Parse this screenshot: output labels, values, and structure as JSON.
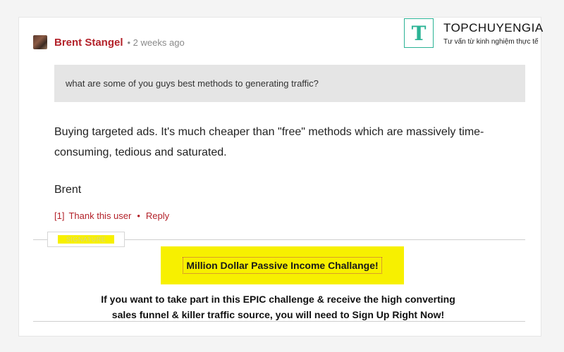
{
  "post": {
    "author": "Brent Stangel",
    "meta": "• 2 weeks ago",
    "quote": "what are some of you guys best methods to generating traffic?",
    "body_line1": "Buying targeted ads. It's much cheaper than \"free\" methods which are massively time-",
    "body_line2": "consuming, tedious and saturated.",
    "signoff": "Brent",
    "thanks_count": "[1]",
    "thank_label": "Thank this user",
    "separator": "•",
    "reply_label": "Reply"
  },
  "signature": {
    "label": "SIGNATURE",
    "promo_title": "Million Dollar Passive Income Challange!",
    "promo_line1": "If you want to take part in this EPIC challenge & receive the high converting",
    "promo_line2": "sales funnel & killer traffic source, you will need to Sign Up Right Now!"
  },
  "watermark": {
    "icon_letter": "T",
    "title": "TOPCHUYENGIA",
    "subtitle": "Tư vấn từ kinh nghiệm thực tế"
  },
  "colors": {
    "author": "#b3222a",
    "highlight": "#f7f000",
    "brand": "#2bb395",
    "quote_bg": "#e5e5e5"
  }
}
